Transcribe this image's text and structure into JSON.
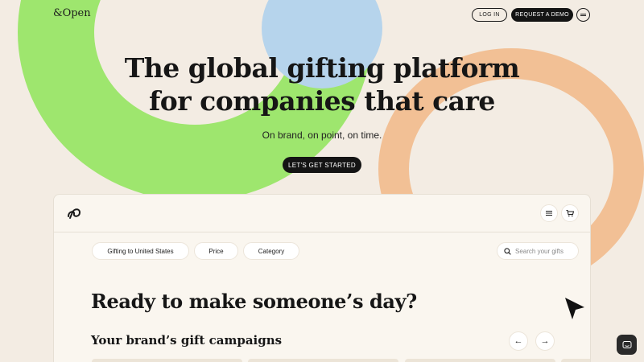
{
  "header": {
    "logo": "&Open",
    "login_label": "LOG IN",
    "demo_label": "REQUEST A DEMO",
    "menu_icon": "hamburger-icon"
  },
  "hero": {
    "title_line1": "The global gifting platform",
    "title_line2": "for companies that care",
    "subtitle": "On brand, on point, on time.",
    "cta_label": "LET'S GET STARTED"
  },
  "app": {
    "logo_icon": "infinity-logo-icon",
    "menu_icon": "hamburger-icon",
    "cart_icon": "cart-icon",
    "filters": [
      "Gifting to United States",
      "Price",
      "Category"
    ],
    "search_placeholder": "Search your gifts",
    "headline": "Ready to make someone’s day?",
    "campaigns_title": "Your brand’s gift campaigns",
    "prev_icon": "←",
    "next_icon": "→"
  },
  "colors": {
    "background": "#f3ece3",
    "green": "#9ee66e",
    "peach": "#f2c095",
    "blue": "#b6d4ec",
    "dark": "#141414"
  }
}
